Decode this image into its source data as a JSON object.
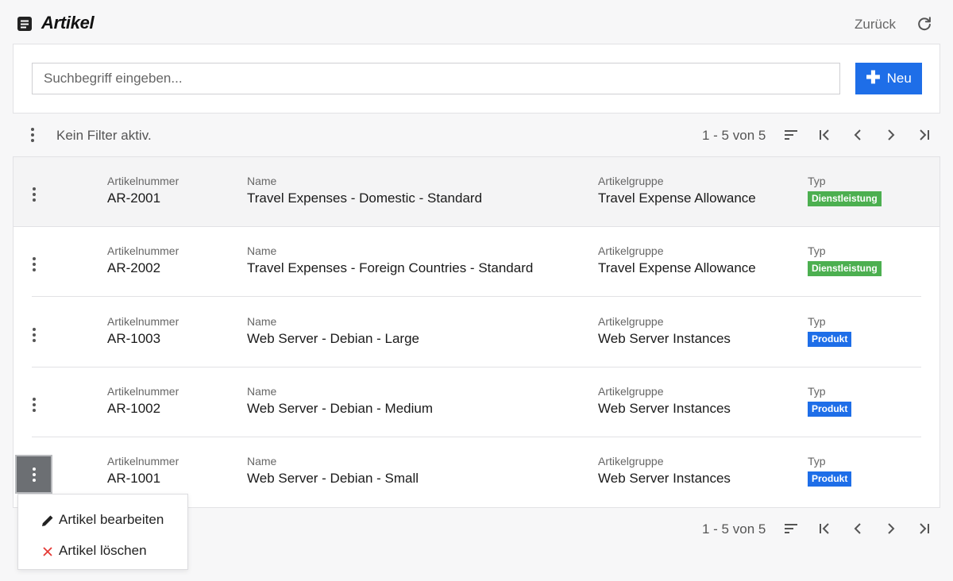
{
  "header": {
    "title": "Artikel",
    "back_label": "Zurück"
  },
  "search": {
    "placeholder": "Suchbegriff eingeben...",
    "value": ""
  },
  "toolbar": {
    "new_label": "Neu",
    "filter_status": "Kein Filter aktiv.",
    "range_top": "1 - 5 von 5",
    "range_bottom": "1 - 5 von 5"
  },
  "columns": {
    "number": "Artikelnummer",
    "name": "Name",
    "group": "Artikelgruppe",
    "type": "Typ"
  },
  "rows": [
    {
      "number": "AR-2001",
      "name": "Travel Expenses - Domestic - Standard",
      "group": "Travel Expense Allowance",
      "type": "Dienstleistung",
      "type_color": "#4caf50"
    },
    {
      "number": "AR-2002",
      "name": "Travel Expenses - Foreign Countries - Standard",
      "group": "Travel Expense Allowance",
      "type": "Dienstleistung",
      "type_color": "#4caf50"
    },
    {
      "number": "AR-1003",
      "name": "Web Server - Debian - Large",
      "group": "Web Server Instances",
      "type": "Produkt",
      "type_color": "#1e6ee8"
    },
    {
      "number": "AR-1002",
      "name": "Web Server - Debian - Medium",
      "group": "Web Server Instances",
      "type": "Produkt",
      "type_color": "#1e6ee8"
    },
    {
      "number": "AR-1001",
      "name": "Web Server - Debian - Small",
      "group": "Web Server Instances",
      "type": "Produkt",
      "type_color": "#1e6ee8"
    }
  ],
  "context_menu": {
    "edit_label": "Artikel bearbeiten",
    "delete_label": "Artikel löschen"
  },
  "colors": {
    "accent": "#1e6ee8",
    "service_badge": "#4caf50",
    "product_badge": "#1e6ee8",
    "delete_icon": "#e53935"
  },
  "icons": {
    "title": "document-icon",
    "reload": "reload-icon",
    "new": "plus-icon",
    "sort": "sort-icon",
    "first": "first-page-icon",
    "prev": "chevron-left-icon",
    "next": "chevron-right-icon",
    "last": "last-page-icon",
    "edit": "pencil-icon",
    "delete": "close-icon"
  }
}
